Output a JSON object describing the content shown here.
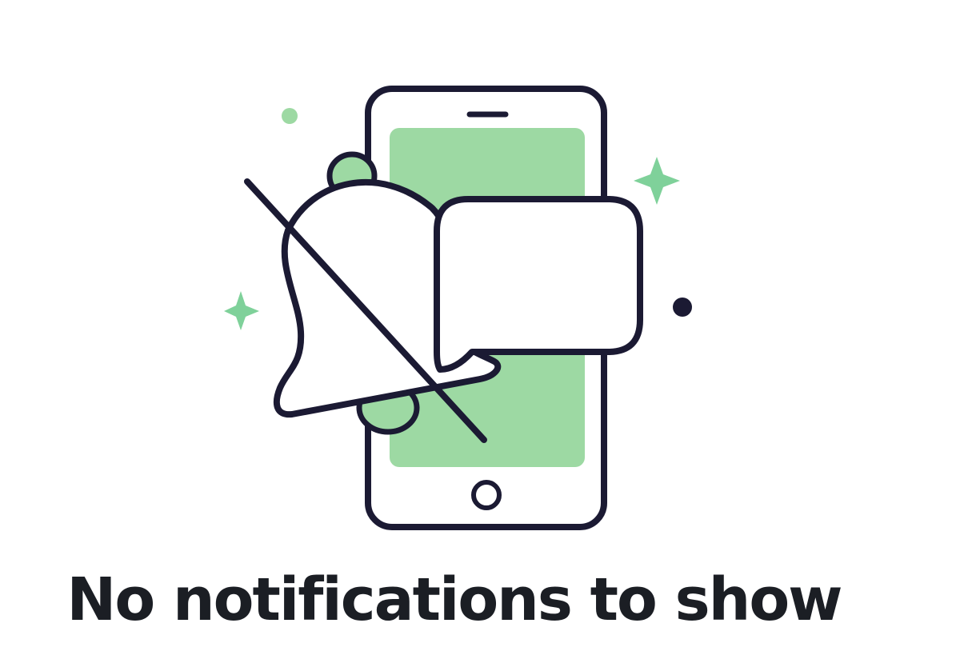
{
  "empty_state": {
    "message": "No notifications to show"
  },
  "illustration": {
    "icons": [
      "phone-icon",
      "bell-off-icon",
      "chat-bubble-icon",
      "sparkle-icon",
      "dot-icon"
    ],
    "colors": {
      "outline": "#1b1a33",
      "accent": "#9dd9a3",
      "accent_sparkle": "#7fd19a",
      "background": "#ffffff",
      "text": "#1b1e24"
    }
  }
}
